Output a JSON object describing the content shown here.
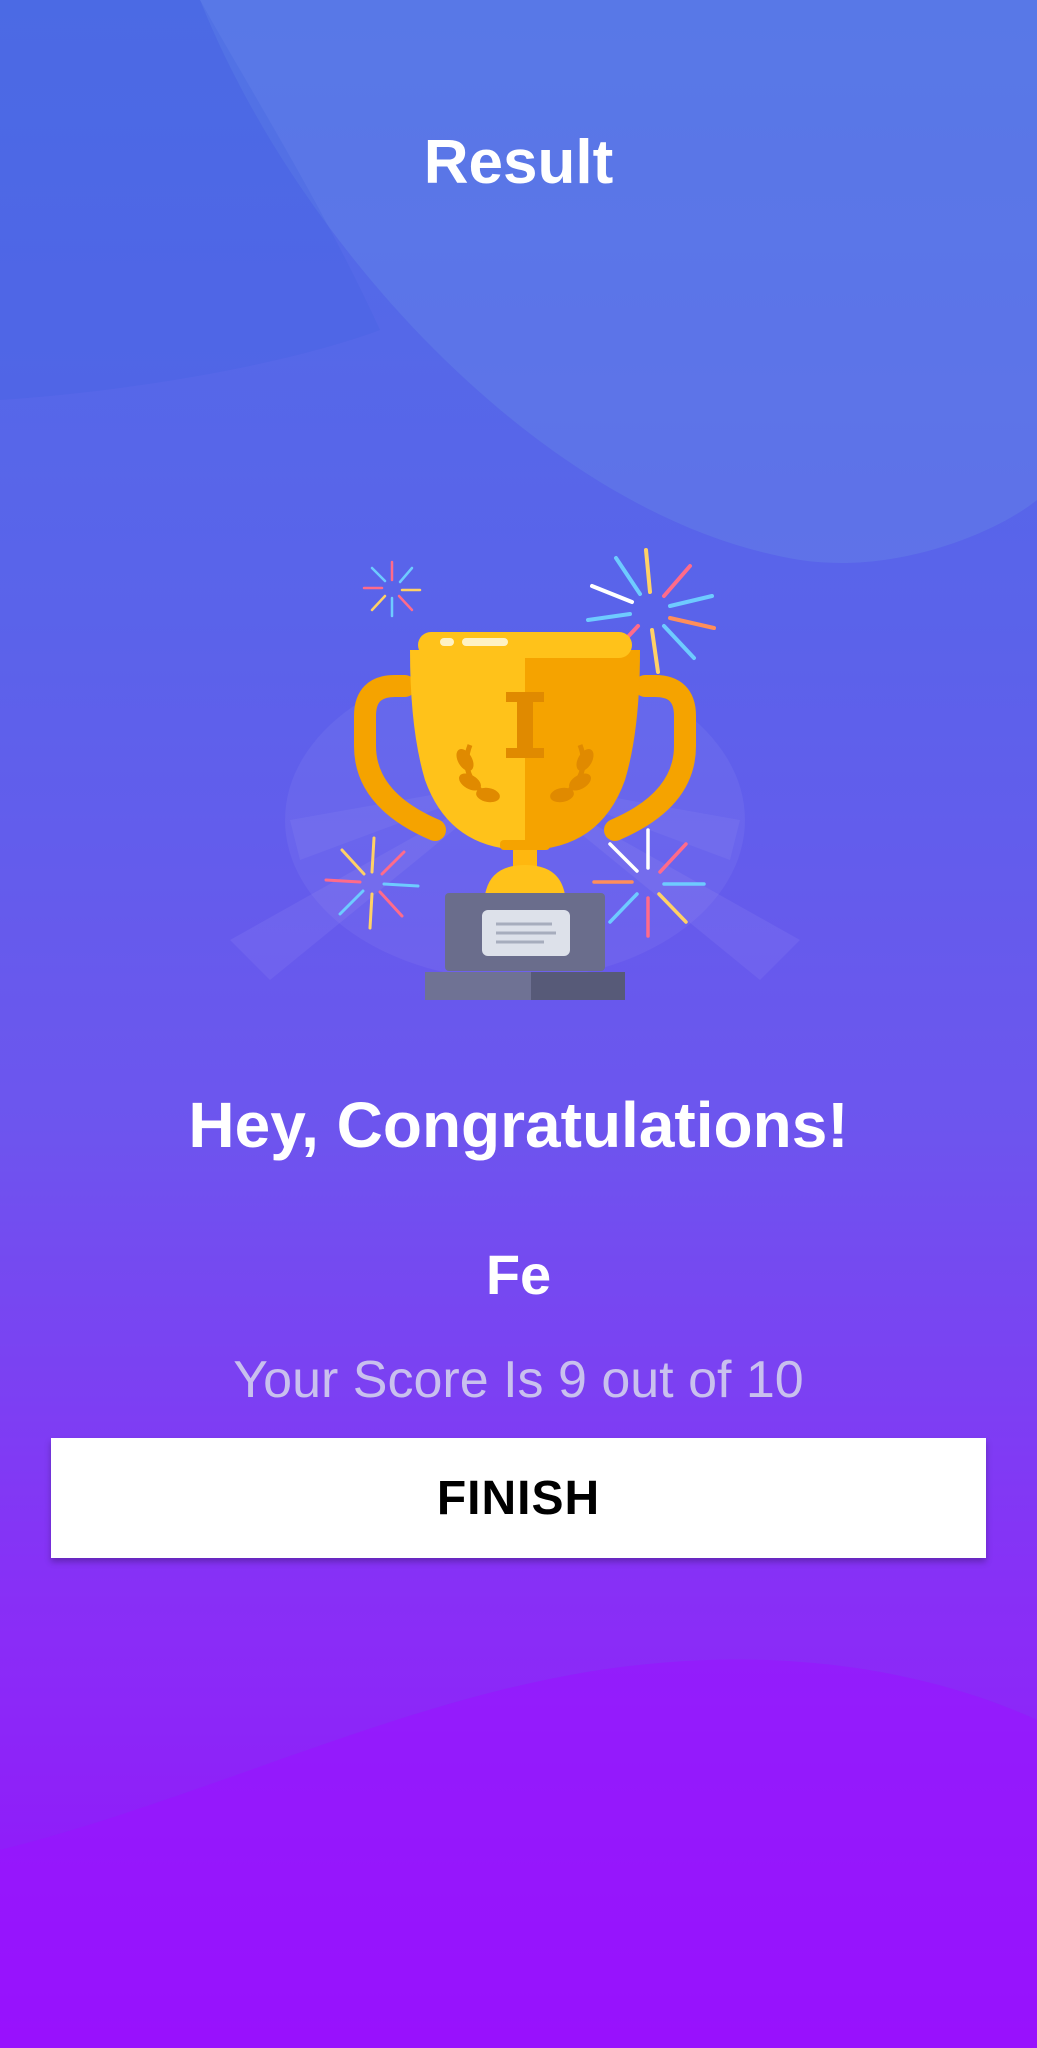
{
  "header": {
    "title": "Result"
  },
  "illustration": {
    "icon": "trophy-with-fireworks-icon",
    "colors": {
      "cup": "#ffb70f",
      "cup_shade": "#f5a300",
      "base": "#5e6180",
      "plate": "#d9dde6"
    }
  },
  "result": {
    "congrats_text": "Hey, Congratulations!",
    "user_name": "Fe",
    "score_text": "Your Score Is 9 out of 10"
  },
  "actions": {
    "finish_label": "FINISH"
  },
  "colors": {
    "background_top": "#4f6ee6",
    "background_bottom": "#9410fb",
    "button_bg": "#ffffff",
    "button_text": "#000000",
    "score_text": "#c9c0ee"
  }
}
